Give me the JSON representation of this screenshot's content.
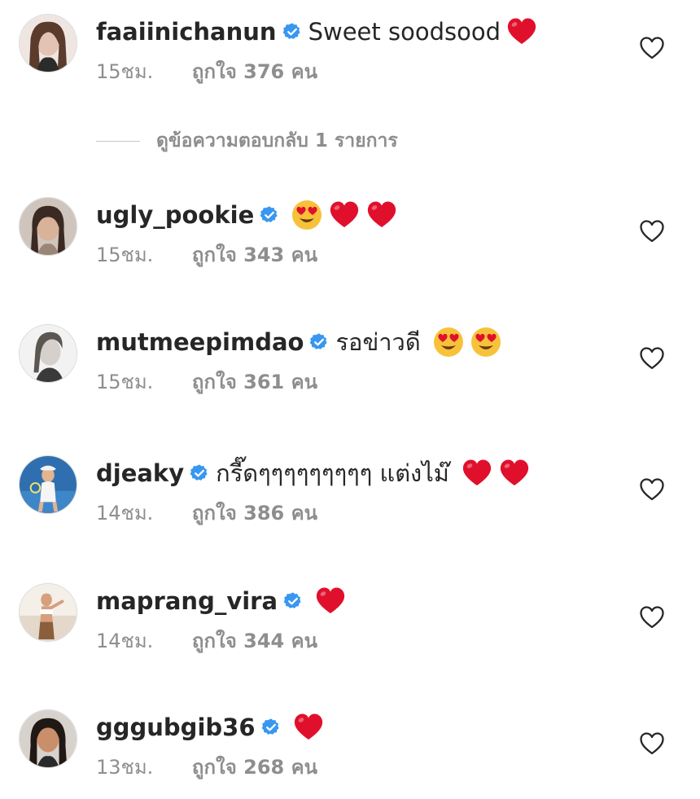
{
  "comments": [
    {
      "username": "faaiinichanun",
      "text": "Sweet soodsood",
      "emojis": [
        "red-heart"
      ],
      "time": "15ชม.",
      "likes": "ถูกใจ 376 คน",
      "avatar_color": "#c9a79a"
    },
    {
      "username": "ugly_pookie",
      "text": "",
      "emojis": [
        "heart-eyes",
        "red-heart",
        "red-heart"
      ],
      "time": "15ชม.",
      "likes": "ถูกใจ 343 คน",
      "avatar_color": "#8f7a6c"
    },
    {
      "username": "mutmeepimdao",
      "text": "รอข่าวดี",
      "emojis": [
        "heart-eyes",
        "heart-eyes"
      ],
      "time": "15ชม.",
      "likes": "ถูกใจ 361 คน",
      "avatar_color": "#d9d9d9"
    },
    {
      "username": "djeaky",
      "text": "กรี๊ดๆๆๆๆๆๆๆๆๆ แต่งไม๊",
      "emojis": [
        "red-heart",
        "red-heart"
      ],
      "time": "14ชม.",
      "likes": "ถูกใจ 386 คน",
      "avatar_color": "#2f6fb0"
    },
    {
      "username": "maprang_vira",
      "text": "",
      "emojis": [
        "red-heart"
      ],
      "time": "14ชม.",
      "likes": "ถูกใจ 344 คน",
      "avatar_color": "#e7dccf"
    },
    {
      "username": "gggubgib36",
      "text": "",
      "emojis": [
        "red-heart"
      ],
      "time": "13ชม.",
      "likes": "ถูกใจ 268 คน",
      "avatar_color": "#5b4a43"
    }
  ],
  "view_replies": "ดูข้อความตอบกลับ 1 รายการ",
  "colors": {
    "text": "#262626",
    "secondary": "#8e8e8e",
    "verified": "#3897f0",
    "heart": "#e0102d"
  },
  "icons": {
    "verified": "verified-badge-icon",
    "like": "heart-outline-icon",
    "red_heart": "red-heart-emoji",
    "heart_eyes": "heart-eyes-emoji"
  }
}
